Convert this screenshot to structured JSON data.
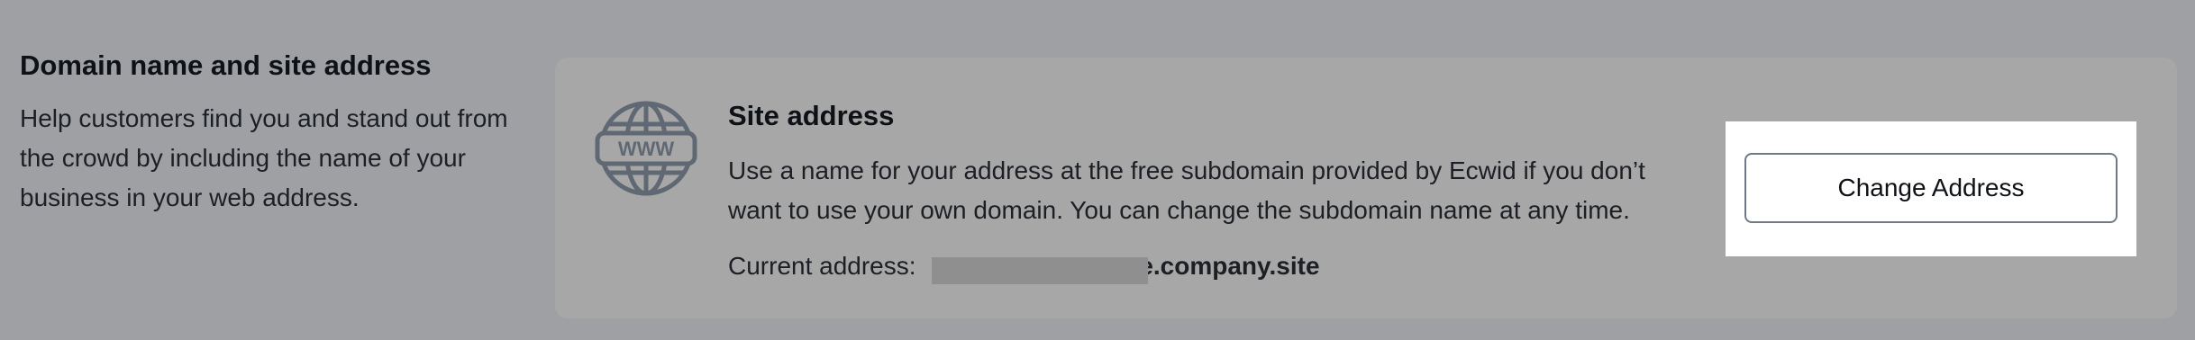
{
  "section": {
    "title": "Domain name and site address",
    "description": "Help customers find you and stand out from the crowd by including the name of your business in your web address."
  },
  "card": {
    "icon": "www-globe-icon",
    "icon_text": "WWW",
    "title": "Site address",
    "description": "Use a name for your address at the free subdomain provided by Ecwid if you don’t want to use your own domain. You can change the subdomain name at any time.",
    "current_label": "Current address:",
    "current_value": "e.company.site"
  },
  "button": {
    "label": "Change Address"
  },
  "colors": {
    "background": "#9ea0a3",
    "card": "#a7a7a7",
    "icon": "#5f6873",
    "button_border": "#6f7a86"
  }
}
